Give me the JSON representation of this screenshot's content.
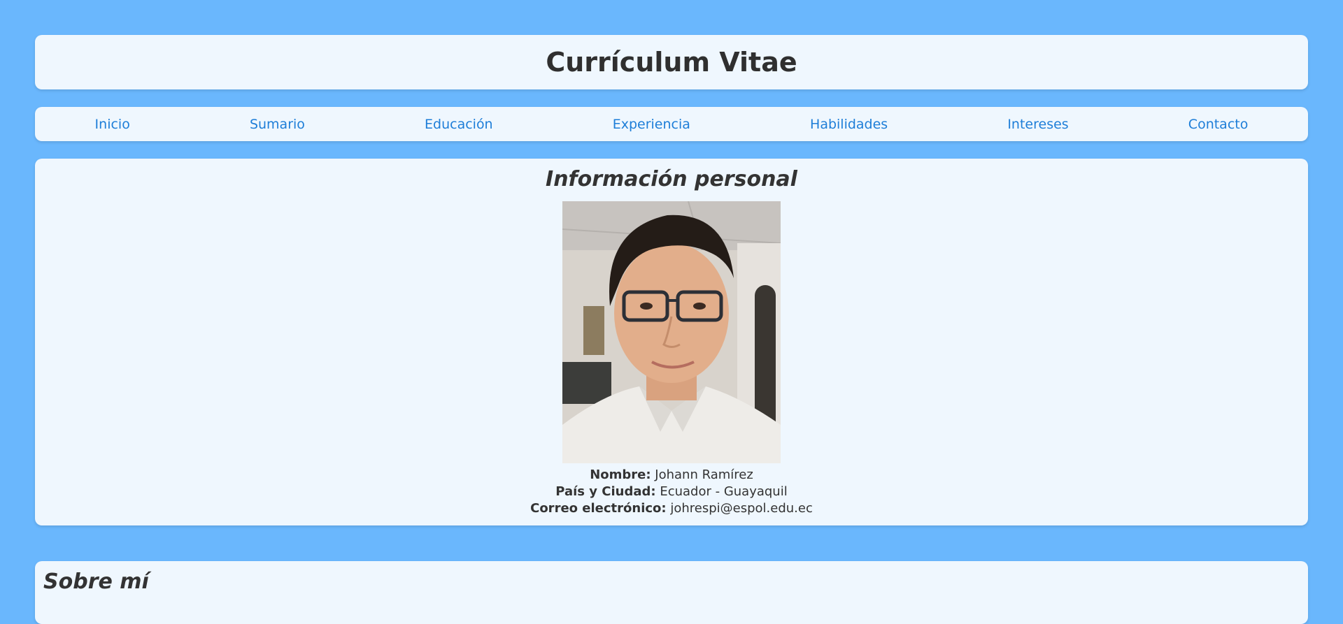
{
  "header": {
    "title": "Currículum Vitae"
  },
  "nav": {
    "items": [
      {
        "label": "Inicio"
      },
      {
        "label": "Sumario"
      },
      {
        "label": "Educación"
      },
      {
        "label": "Experiencia"
      },
      {
        "label": "Habilidades"
      },
      {
        "label": "Intereses"
      },
      {
        "label": "Contacto"
      }
    ]
  },
  "personal": {
    "title": "Información personal",
    "name_label": "Nombre:",
    "name_value": "Johann Ramírez",
    "location_label": "País y Ciudad:",
    "location_value": "Ecuador - Guayaquil",
    "email_label": "Correo electrónico:",
    "email_value": "johrespi@espol.edu.ec"
  },
  "about": {
    "title": "Sobre mí"
  },
  "colors": {
    "background": "#6ab7fd",
    "card": "#eff7fe",
    "link": "#1e7ed8",
    "text": "#333333"
  }
}
